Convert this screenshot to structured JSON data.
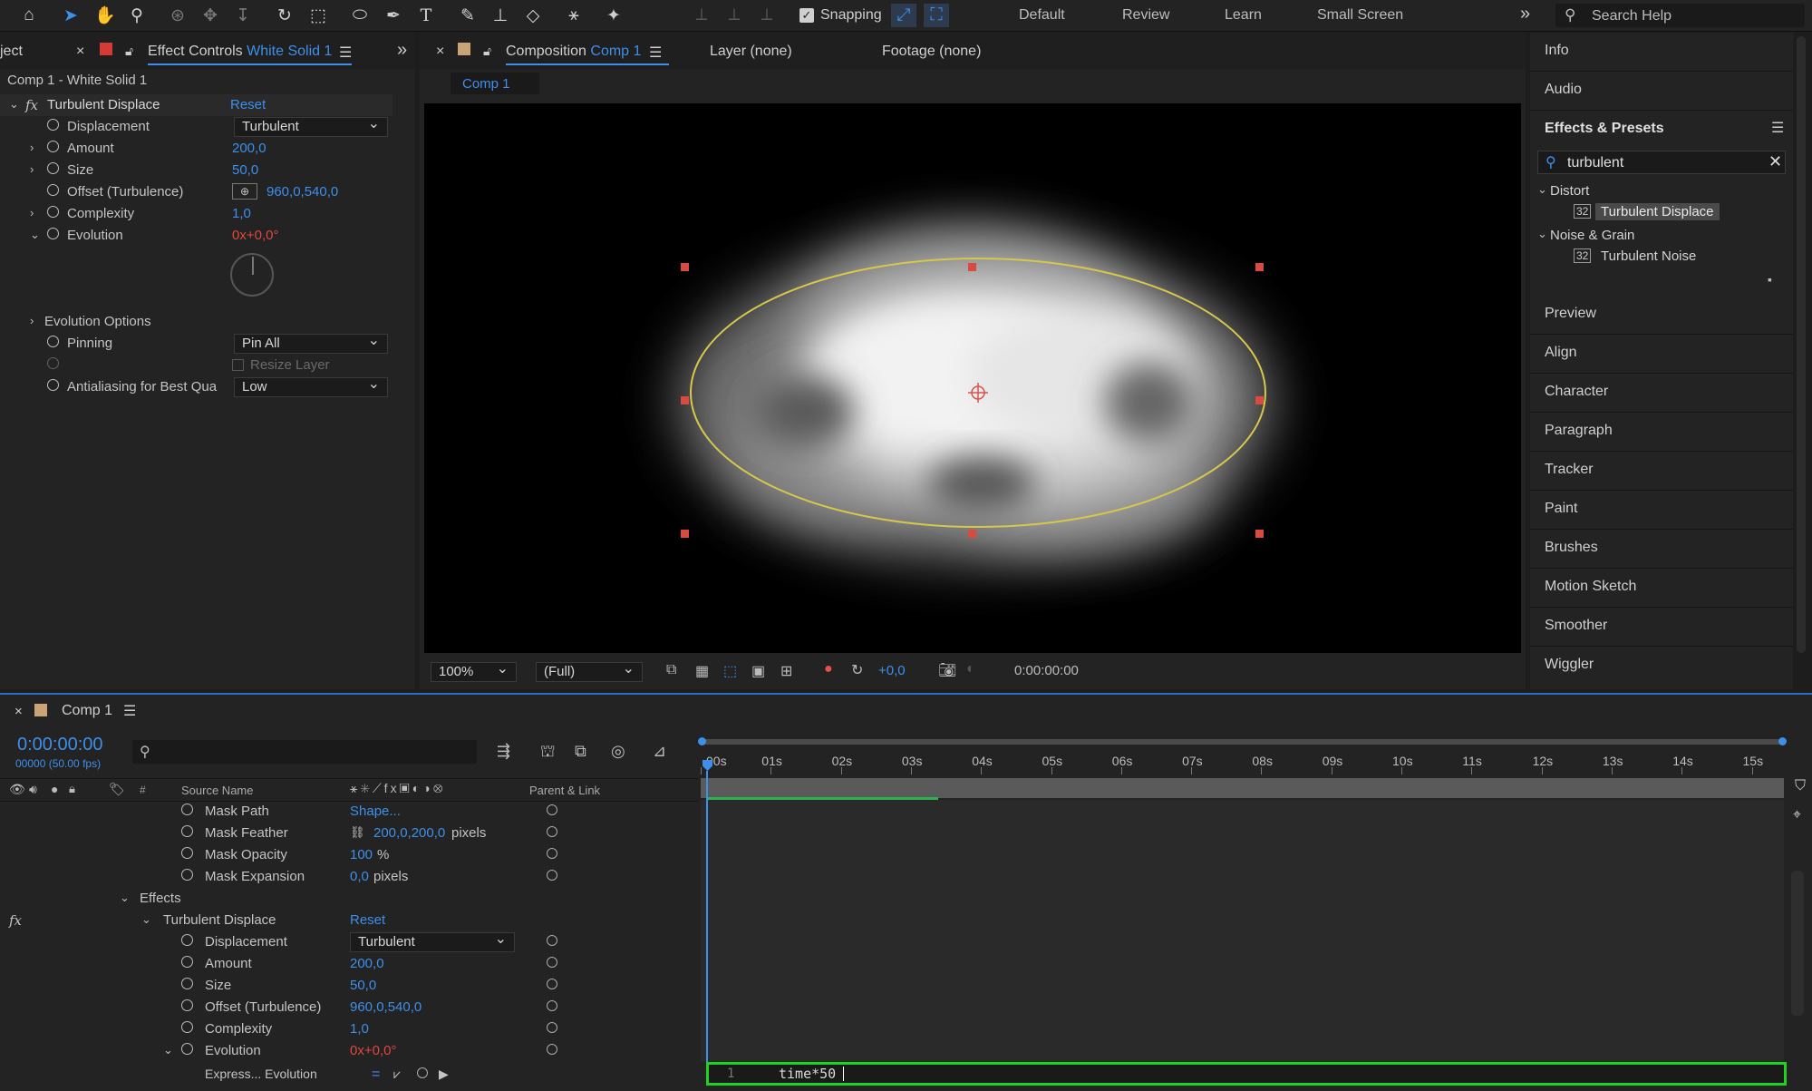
{
  "toolbar": {
    "snapping_label": "Snapping",
    "workspaces": [
      "Default",
      "Review",
      "Learn",
      "Small Screen"
    ],
    "search_placeholder": "Search Help"
  },
  "left_panel": {
    "tab_partial": "ject",
    "tab_title": "Effect Controls",
    "tab_title_layer": "White Solid 1",
    "breadcrumb": "Comp 1 - White Solid 1",
    "effect_name": "Turbulent Displace",
    "reset_label": "Reset",
    "properties": {
      "displacement": {
        "label": "Displacement",
        "value": "Turbulent"
      },
      "amount": {
        "label": "Amount",
        "value": "200,0"
      },
      "size": {
        "label": "Size",
        "value": "50,0"
      },
      "offset": {
        "label": "Offset (Turbulence)",
        "value": "960,0,540,0"
      },
      "complexity": {
        "label": "Complexity",
        "value": "1,0"
      },
      "evolution": {
        "label": "Evolution",
        "value": "0x+0,0°"
      },
      "evolution_options": {
        "label": "Evolution Options"
      },
      "pinning": {
        "label": "Pinning",
        "value": "Pin All"
      },
      "resize_layer": {
        "label": "Resize Layer"
      },
      "antialiasing": {
        "label": "Antialiasing for Best Qua",
        "value": "Low"
      }
    }
  },
  "composition": {
    "tab_title": "Composition",
    "tab_comp": "Comp 1",
    "layer_tab": "Layer (none)",
    "footage_tab": "Footage (none)",
    "subtab": "Comp 1",
    "zoom": "100%",
    "resolution": "(Full)",
    "exposure": "+0,0",
    "timecode": "0:00:00:00"
  },
  "right_panel": {
    "info": "Info",
    "audio": "Audio",
    "effects_presets": "Effects & Presets",
    "search_value": "turbulent",
    "categories": [
      {
        "name": "Distort",
        "item": "Turbulent Displace"
      },
      {
        "name": "Noise & Grain",
        "item": "Turbulent Noise"
      }
    ],
    "panels": [
      "Preview",
      "Align",
      "Character",
      "Paragraph",
      "Tracker",
      "Paint",
      "Brushes",
      "Motion Sketch",
      "Smoother",
      "Wiggler"
    ]
  },
  "timeline": {
    "tab_title": "Comp 1",
    "timecode": "0:00:00:00",
    "frames": "00000 (50.00 fps)",
    "headers": {
      "source_name": "Source Name",
      "parent_link": "Parent & Link",
      "num": "#"
    },
    "rows": {
      "mask_path": {
        "label": "Mask Path",
        "value": "Shape..."
      },
      "mask_feather": {
        "label": "Mask Feather",
        "value": "200,0,200,0",
        "unit": "pixels"
      },
      "mask_opacity": {
        "label": "Mask Opacity",
        "value": "100",
        "unit": "%"
      },
      "mask_expansion": {
        "label": "Mask Expansion",
        "value": "0,0",
        "unit": "pixels"
      },
      "effects": {
        "label": "Effects"
      },
      "turbulent": {
        "label": "Turbulent Displace",
        "value": "Reset"
      },
      "displacement": {
        "label": "Displacement",
        "value": "Turbulent"
      },
      "amount": {
        "label": "Amount",
        "value": "200,0"
      },
      "size": {
        "label": "Size",
        "value": "50,0"
      },
      "offset": {
        "label": "Offset (Turbulence)",
        "value": "960,0,540,0"
      },
      "complexity": {
        "label": "Complexity",
        "value": "1,0"
      },
      "evolution": {
        "label": "Evolution",
        "value": "0x+0,0°"
      },
      "expression": {
        "label": "Express... Evolution"
      }
    },
    "ruler": [
      "00s",
      "01s",
      "02s",
      "03s",
      "04s",
      "05s",
      "06s",
      "07s",
      "08s",
      "09s",
      "10s",
      "11s",
      "12s",
      "13s",
      "14s",
      "15s"
    ],
    "expression_line": "1",
    "expression_text": "time*50"
  }
}
